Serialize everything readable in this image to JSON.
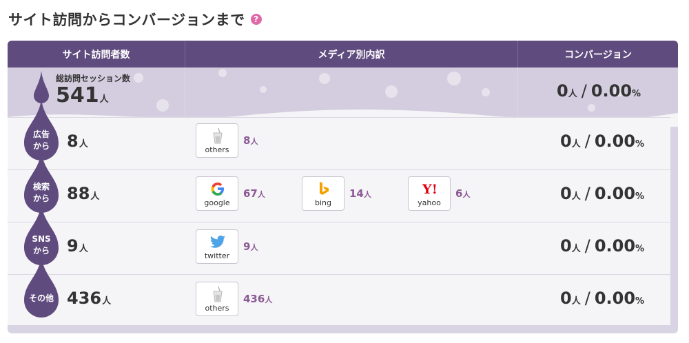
{
  "page": {
    "title": "サイト訪問からコンバージョンまで",
    "help_icon": "?"
  },
  "colors": {
    "header_bg": "#5f4b7e",
    "accent": "#8b5a94",
    "drop": "#5f4b7e",
    "help": "#e06aa8"
  },
  "header": {
    "col1": "サイト訪問者数",
    "col2": "メディア別内訳",
    "col3": "コンバージョン"
  },
  "summary": {
    "label": "総訪問セッション数",
    "value": "541",
    "unit": "人",
    "conversion": {
      "count": "0",
      "count_unit": "人",
      "slash": "/",
      "rate": "0.00",
      "rate_unit": "%"
    }
  },
  "rows": [
    {
      "source_line1": "広告",
      "source_line2": "から",
      "value": "8",
      "unit": "人",
      "media": [
        {
          "icon": "others-cup-icon",
          "name": "others",
          "count": "8",
          "unit": "人"
        }
      ],
      "conversion": {
        "count": "0",
        "count_unit": "人",
        "slash": "/",
        "rate": "0.00",
        "rate_unit": "%"
      }
    },
    {
      "source_line1": "検索",
      "source_line2": "から",
      "value": "88",
      "unit": "人",
      "media": [
        {
          "icon": "google-icon",
          "name": "google",
          "count": "67",
          "unit": "人"
        },
        {
          "icon": "bing-icon",
          "name": "bing",
          "count": "14",
          "unit": "人"
        },
        {
          "icon": "yahoo-icon",
          "name": "yahoo",
          "count": "6",
          "unit": "人"
        }
      ],
      "conversion": {
        "count": "0",
        "count_unit": "人",
        "slash": "/",
        "rate": "0.00",
        "rate_unit": "%"
      }
    },
    {
      "source_line1": "SNS",
      "source_line2": "から",
      "value": "9",
      "unit": "人",
      "media": [
        {
          "icon": "twitter-icon",
          "name": "twitter",
          "count": "9",
          "unit": "人"
        }
      ],
      "conversion": {
        "count": "0",
        "count_unit": "人",
        "slash": "/",
        "rate": "0.00",
        "rate_unit": "%"
      }
    },
    {
      "source_line1": "その他",
      "source_line2": "",
      "value": "436",
      "unit": "人",
      "media": [
        {
          "icon": "others-cup-icon",
          "name": "others",
          "count": "436",
          "unit": "人"
        }
      ],
      "conversion": {
        "count": "0",
        "count_unit": "人",
        "slash": "/",
        "rate": "0.00",
        "rate_unit": "%"
      }
    }
  ]
}
